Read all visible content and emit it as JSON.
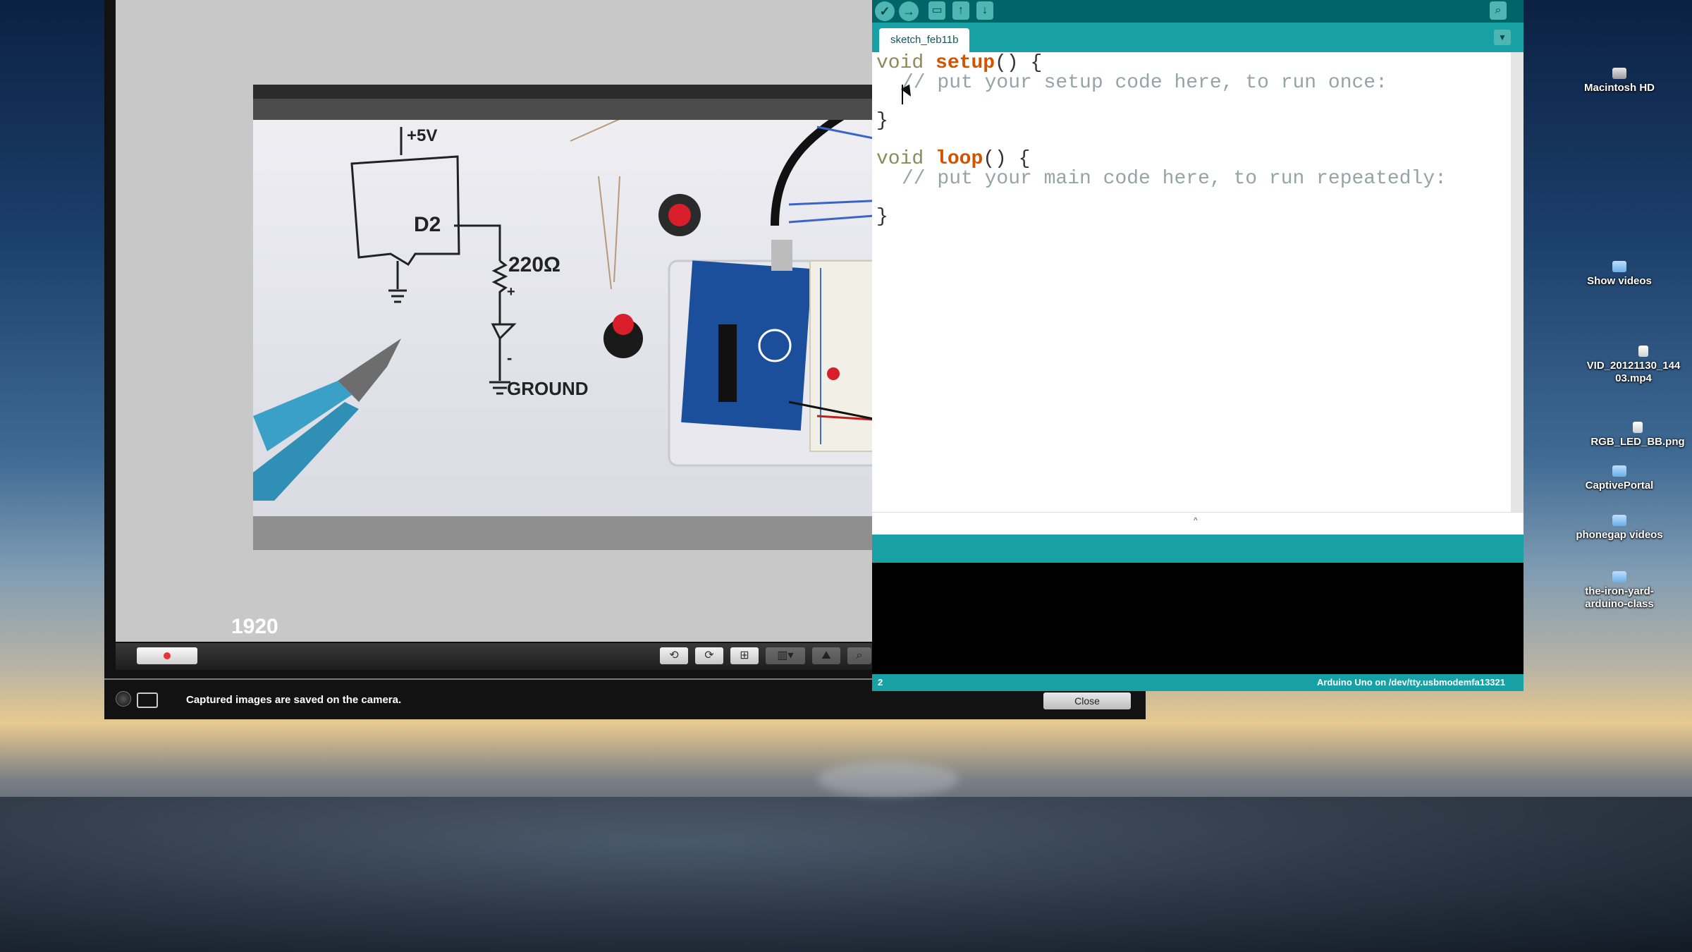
{
  "desktop": {
    "icons": [
      {
        "label": "Macintosh HD",
        "icon": "hard-drive-icon"
      },
      {
        "label": "Show videos",
        "icon": "folder-icon"
      },
      {
        "label": "VID_20121130_144 03.mp4",
        "icon": "video-file-icon"
      },
      {
        "label": "RGB_LED_BB.png",
        "icon": "image-file-icon"
      },
      {
        "label": "CaptivePortal",
        "icon": "folder-icon"
      },
      {
        "label": "phonegap videos",
        "icon": "folder-icon"
      },
      {
        "label": "the-iron-yard-arduino-class",
        "icon": "folder-icon"
      }
    ]
  },
  "camera_window": {
    "logo_text": "1920",
    "status_message": "Captured images are saved on the camera.",
    "close_label": "Close",
    "toolbar_icons": [
      "rotate-left-icon",
      "rotate-right-icon",
      "grid-icon",
      "layout-icon",
      "mountain-icon",
      "magnifier-icon"
    ]
  },
  "arduino": {
    "toolbar_icons": [
      "verify-icon",
      "upload-icon",
      "new-icon",
      "open-icon",
      "save-icon",
      "serial-monitor-icon"
    ],
    "tab_name": "sketch_feb11b",
    "code": {
      "l1_kw": "void",
      "l1_fn": "setup",
      "l1_rest": "() {",
      "l2_comment": "// put your setup code here, to run once:",
      "l3_brace": "}",
      "l5_kw": "void",
      "l5_fn": "loop",
      "l5_rest": "() {",
      "l6_comment": "// put your main code here, to run repeatedly:",
      "l7_brace": "}"
    },
    "status_line_number": "2",
    "board_info": "Arduino Uno on /dev/tty.usbmodemfa13321",
    "colors": {
      "dark_teal": "#006468",
      "teal": "#17a1a5",
      "keyword_orange": "#d35400"
    }
  }
}
